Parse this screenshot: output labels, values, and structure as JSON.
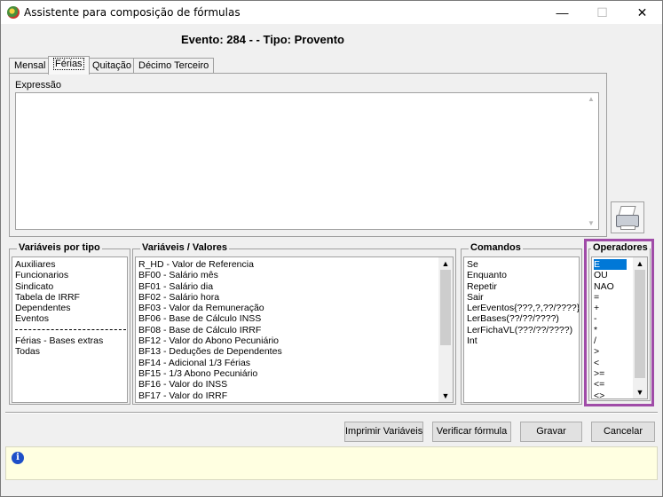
{
  "window": {
    "title": "Assistente para composição de fórmulas",
    "minimize": "—",
    "maximize": "☐",
    "close": "✕"
  },
  "heading": "Evento: 284 -  - Tipo: Provento",
  "tabs": [
    {
      "label": "Mensal",
      "active": false
    },
    {
      "label": "Férias",
      "active": true
    },
    {
      "label": "Quitação",
      "active": false
    },
    {
      "label": "Décimo Terceiro",
      "active": false
    }
  ],
  "expression": {
    "label": "Expressão",
    "value": ""
  },
  "groups": {
    "variaveis_tipo": {
      "title": "Variáveis por tipo",
      "items_top": [
        "Auxiliares",
        "Funcionarios",
        "Sindicato",
        "Tabela de IRRF",
        "Dependentes",
        "Eventos"
      ],
      "items_bottom": [
        "Férias - Bases extras",
        "Todas"
      ]
    },
    "variaveis_valores": {
      "title": "Variáveis / Valores",
      "items": [
        "R_HD - Valor de Referencia",
        "BF00 - Salário mês",
        "BF01 - Salário dia",
        "BF02 - Salário hora",
        "BF03 - Valor da Remuneração",
        "BF06 - Base de Cálculo INSS",
        "BF08 - Base de Cálculo IRRF",
        "BF12 - Valor do Abono Pecuniário",
        "BF13 - Deduções de Dependentes",
        "BF14 - Adicional 1/3 Férias",
        "BF15 - 1/3 Abono Pecuniário",
        "BF16 - Valor do INSS",
        "BF17 - Valor do IRRF"
      ]
    },
    "comandos": {
      "title": "Comandos",
      "items": [
        "Se",
        "Enquanto",
        "Repetir",
        "Sair",
        "LerEventos{???,?,??/????}",
        "LerBases(??/??/????)",
        "LerFichaVL(???/??/????)",
        "Int"
      ]
    },
    "operadores": {
      "title": "Operadores",
      "selected": "E",
      "items": [
        "E",
        "OU",
        "NAO",
        "=",
        "+",
        "-",
        "*",
        "/",
        ">",
        "<",
        ">=",
        "<=",
        "<>"
      ]
    }
  },
  "buttons": {
    "imprimir": "Imprimir Variáveis",
    "verificar": "Verificar fórmula",
    "gravar": "Gravar",
    "cancelar": "Cancelar"
  },
  "status": {
    "text": ""
  },
  "colors": {
    "selection": "#0078d7",
    "highlight_border": "#a04ca8",
    "status_bg": "#ffffe1"
  }
}
